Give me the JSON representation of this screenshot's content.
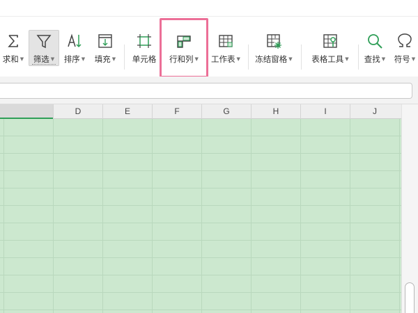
{
  "ribbon": {
    "tools": [
      {
        "id": "sum",
        "label": "求和",
        "icon": "sigma-icon"
      },
      {
        "id": "filter",
        "label": "筛选",
        "icon": "funnel-icon"
      },
      {
        "id": "sort",
        "label": "排序",
        "icon": "sort-icon"
      },
      {
        "id": "fill",
        "label": "填充",
        "icon": "fill-down-icon"
      },
      {
        "id": "cell",
        "label": "单元格",
        "icon": "cell-icon"
      },
      {
        "id": "row-col",
        "label": "行和列",
        "icon": "row-column-icon"
      },
      {
        "id": "worksheet",
        "label": "工作表",
        "icon": "worksheet-icon"
      },
      {
        "id": "freeze",
        "label": "冻结窗格",
        "icon": "freeze-panes-icon"
      },
      {
        "id": "table-tools",
        "label": "表格工具",
        "icon": "table-tools-icon"
      },
      {
        "id": "find",
        "label": "查找",
        "icon": "magnifier-icon"
      },
      {
        "id": "symbol",
        "label": "符号",
        "icon": "omega-icon"
      }
    ]
  },
  "grid": {
    "columns": [
      "D",
      "E",
      "F",
      "G",
      "H",
      "I",
      "J"
    ]
  },
  "colors": {
    "highlight_border": "#ec6f97",
    "grid_fill": "#cce8cf",
    "selection_accent": "#2e9e57"
  }
}
